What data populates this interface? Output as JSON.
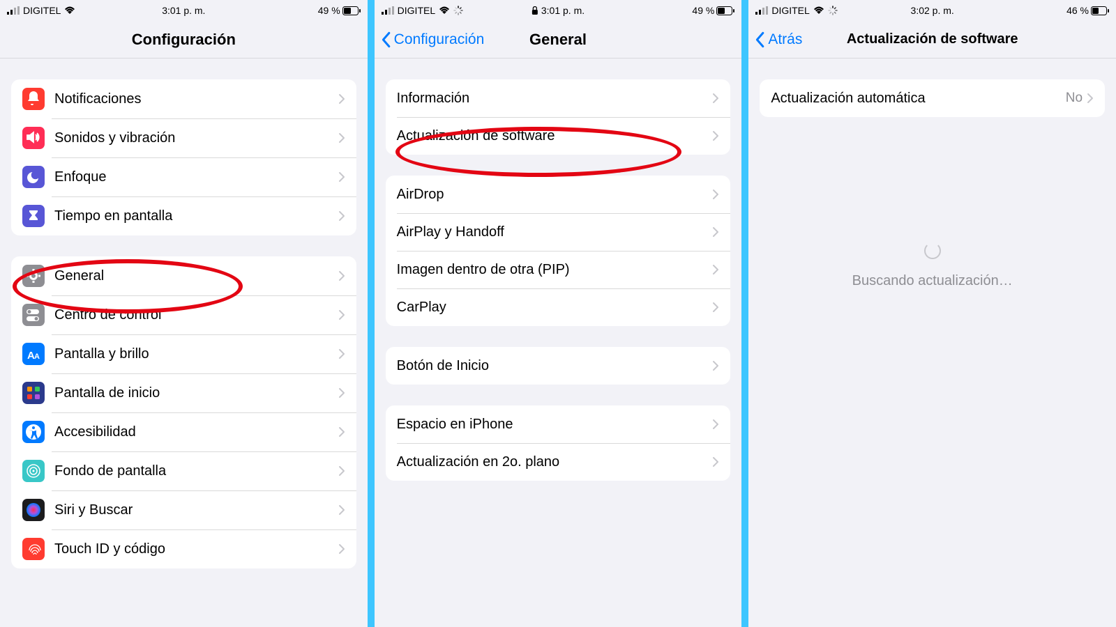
{
  "phone1": {
    "status": {
      "carrier": "DIGITEL",
      "time": "3:01 p. m.",
      "battery": "49 %"
    },
    "title": "Configuración",
    "group1": [
      {
        "label": "Notificaciones",
        "iconColor": "#ff3b30",
        "iconName": "bell-icon"
      },
      {
        "label": "Sonidos y vibración",
        "iconColor": "#ff2d55",
        "iconName": "speaker-icon"
      },
      {
        "label": "Enfoque",
        "iconColor": "#5856d6",
        "iconName": "moon-icon"
      },
      {
        "label": "Tiempo en pantalla",
        "iconColor": "#5856d6",
        "iconName": "hourglass-icon"
      }
    ],
    "group2": [
      {
        "label": "General",
        "iconColor": "#8e8e93",
        "iconName": "gear-icon"
      },
      {
        "label": "Centro de control",
        "iconColor": "#8e8e93",
        "iconName": "toggles-icon"
      },
      {
        "label": "Pantalla y brillo",
        "iconColor": "#007aff",
        "iconName": "text-size-icon"
      },
      {
        "label": "Pantalla de inicio",
        "iconColor": "#2b3a8c",
        "iconName": "home-screen-icon"
      },
      {
        "label": "Accesibilidad",
        "iconColor": "#007aff",
        "iconName": "accessibility-icon"
      },
      {
        "label": "Fondo de pantalla",
        "iconColor": "#38c7c7",
        "iconName": "wallpaper-icon"
      },
      {
        "label": "Siri y Buscar",
        "iconColor": "#1c1c1e",
        "iconName": "siri-icon"
      },
      {
        "label": "Touch ID y código",
        "iconColor": "#ff3b30",
        "iconName": "fingerprint-icon"
      }
    ]
  },
  "phone2": {
    "status": {
      "carrier": "DIGITEL",
      "time": "3:01 p. m.",
      "battery": "49 %"
    },
    "back": "Configuración",
    "title": "General",
    "group1": [
      {
        "label": "Información"
      },
      {
        "label": "Actualización de software"
      }
    ],
    "group2": [
      {
        "label": "AirDrop"
      },
      {
        "label": "AirPlay y Handoff"
      },
      {
        "label": "Imagen dentro de otra (PIP)"
      },
      {
        "label": "CarPlay"
      }
    ],
    "group3": [
      {
        "label": "Botón de Inicio"
      }
    ],
    "group4": [
      {
        "label": "Espacio en iPhone"
      },
      {
        "label": "Actualización en 2o. plano"
      }
    ]
  },
  "phone3": {
    "status": {
      "carrier": "DIGITEL",
      "time": "3:02 p. m.",
      "battery": "46 %"
    },
    "back": "Atrás",
    "title": "Actualización de software",
    "row": {
      "label": "Actualización automática",
      "value": "No"
    },
    "loading": "Buscando actualización…"
  }
}
